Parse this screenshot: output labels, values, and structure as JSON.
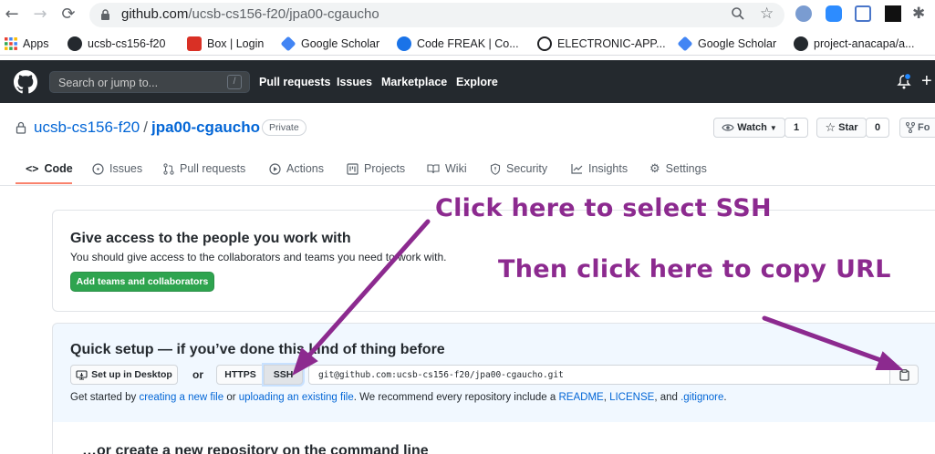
{
  "browser": {
    "url_host": "github.com",
    "url_path": "/ucsb-cs156-f20/jpa00-cgaucho",
    "bookmarks": [
      {
        "label": "Apps",
        "icon": "apps-grid-icon",
        "color": "#ea4335"
      },
      {
        "label": "ucsb-cs156-f20",
        "icon": "github-icon",
        "color": "#24292e"
      },
      {
        "label": "Box | Login",
        "icon": "box-icon",
        "color": "#d93025"
      },
      {
        "label": "Google Scholar",
        "icon": "scholar-icon",
        "color": "#4285f4"
      },
      {
        "label": "Code FREAK | Co...",
        "icon": "codefreak-icon",
        "color": "#1a73e8"
      },
      {
        "label": "ELECTRONIC-APP...",
        "icon": "globe-icon",
        "color": "#202124"
      },
      {
        "label": "Google Scholar",
        "icon": "scholar-icon",
        "color": "#4285f4"
      },
      {
        "label": "project-anacapa/a...",
        "icon": "github-icon",
        "color": "#24292e"
      }
    ]
  },
  "gh_header": {
    "search_placeholder": "Search or jump to...",
    "slash": "/",
    "nav": [
      "Pull requests",
      "Issues",
      "Marketplace",
      "Explore"
    ]
  },
  "repo": {
    "owner": "ucsb-cs156-f20",
    "separator": "/",
    "name": "jpa00-cgaucho",
    "visibility": "Private",
    "watch_label": "Watch",
    "watch_count": "1",
    "star_label": "Star",
    "star_count": "0",
    "fork_label": "Fo"
  },
  "tabs": [
    {
      "label": "Code",
      "icon": "code-icon",
      "selected": true
    },
    {
      "label": "Issues",
      "icon": "issue-icon"
    },
    {
      "label": "Pull requests",
      "icon": "pull-request-icon"
    },
    {
      "label": "Actions",
      "icon": "play-icon"
    },
    {
      "label": "Projects",
      "icon": "project-icon"
    },
    {
      "label": "Wiki",
      "icon": "book-icon"
    },
    {
      "label": "Security",
      "icon": "shield-icon"
    },
    {
      "label": "Insights",
      "icon": "graph-icon"
    },
    {
      "label": "Settings",
      "icon": "gear-icon"
    }
  ],
  "access": {
    "title": "Give access to the people you work with",
    "text": "You should give access to the collaborators and teams you need to work with.",
    "button": "Add teams and collaborators"
  },
  "quick_setup": {
    "title": "Quick setup — if you’ve done this kind of thing before",
    "desktop_button": "Set up in Desktop",
    "or": "or",
    "https": "HTTPS",
    "ssh": "SSH",
    "clone_url": "git@github.com:ucsb-cs156-f20/jpa00-cgaucho.git",
    "hint_1": "Get started by ",
    "hint_link_1": "creating a new file",
    "hint_2": " or ",
    "hint_link_2": "uploading an existing file",
    "hint_3": ". We recommend every repository include a ",
    "hint_link_3": "README",
    "hint_4": ", ",
    "hint_link_4": "LICENSE",
    "hint_5": ", and ",
    "hint_link_5": ".gitignore",
    "hint_6": "."
  },
  "create_repo": {
    "title": "…or create a new repository on the command line"
  },
  "annotations": {
    "ssh": "Click here to select SSH",
    "copy": "Then click here to copy URL",
    "color": "#8c2a8f"
  }
}
